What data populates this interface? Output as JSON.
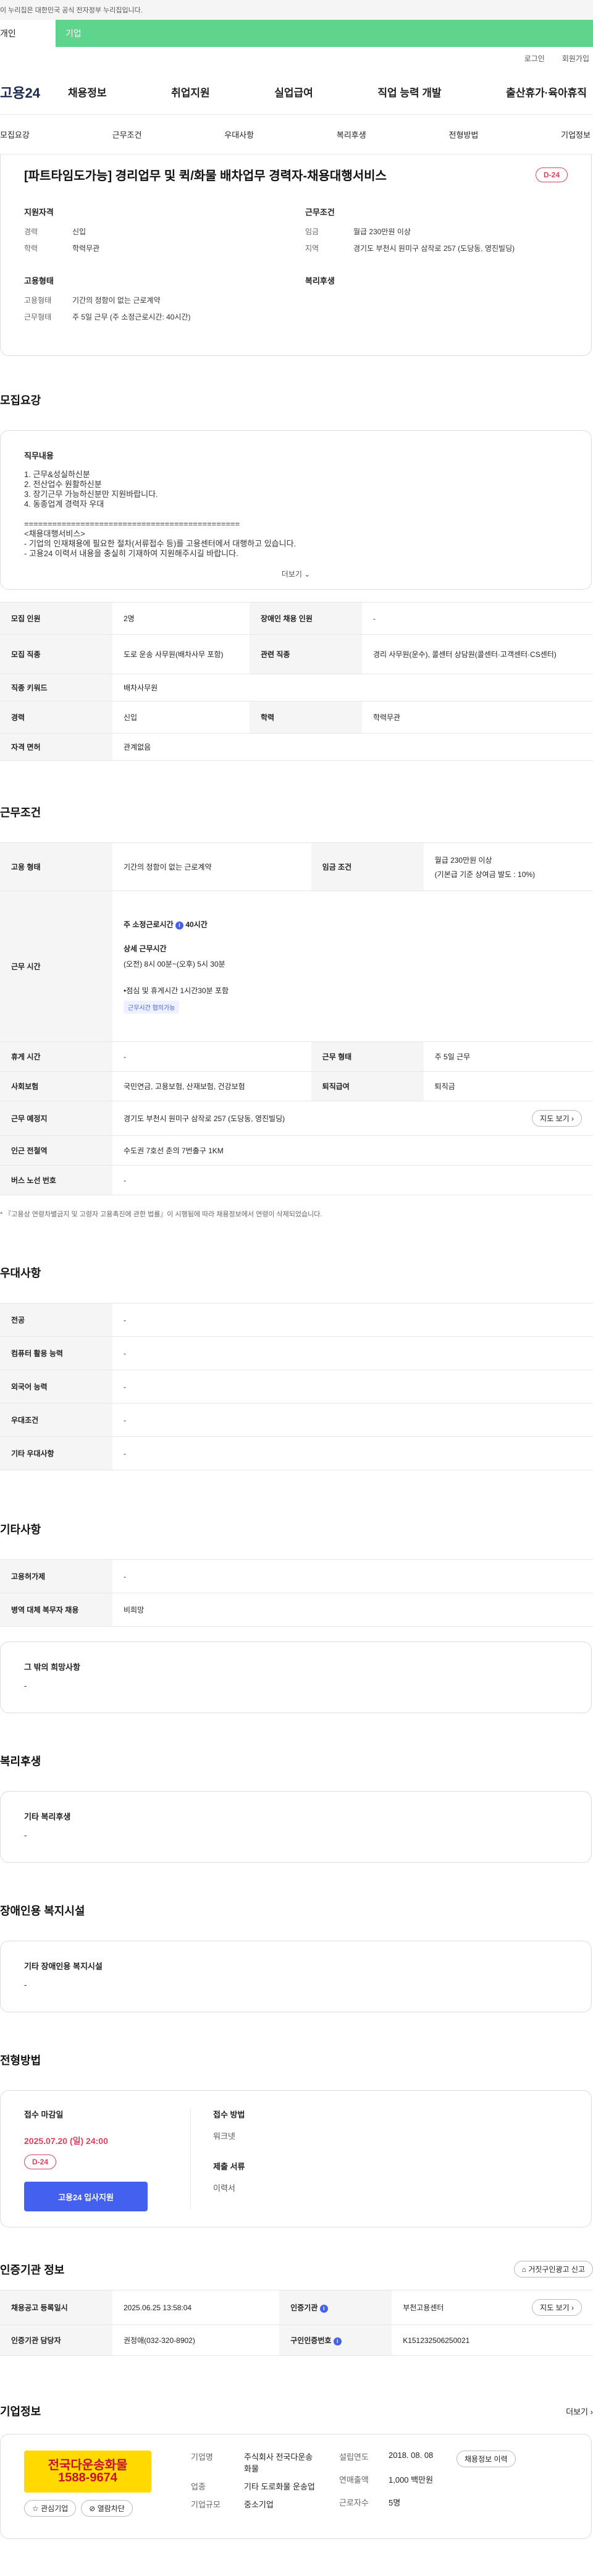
{
  "gov_banner": "이 누리집은 대한민국 공식 전자정부 누리집입니다.",
  "top_tabs": [
    "개인",
    "기업"
  ],
  "util_links": [
    "로그인",
    "회원가입"
  ],
  "brand": "고용24",
  "gnb": [
    "채용정보",
    "취업지원",
    "실업급여",
    "직업 능력 개발",
    "출산휴가·육아휴직"
  ],
  "anchors": [
    "모집요강",
    "근무조건",
    "우대사항",
    "복리후생",
    "전형방법",
    "기업정보"
  ],
  "header": {
    "title": "[파트타임도가능] 경리업무 및 퀵/화물 배차업무 경력자-채용대행서비스",
    "dday": "D-24",
    "qual_title": "지원자격",
    "qual": [
      {
        "k": "경력",
        "v": "신입"
      },
      {
        "k": "학력",
        "v": "학력무관"
      }
    ],
    "cond_title": "근무조건",
    "cond": [
      {
        "k": "임금",
        "v": "월급 230만원 이상"
      },
      {
        "k": "지역",
        "v": "경기도 부천시 원미구 삼작로 257 (도당동, 영진빌딩)"
      }
    ],
    "type_title": "고용형태",
    "type": [
      {
        "k": "고용형태",
        "v": "기간의 정함이 없는 근로계약"
      },
      {
        "k": "근무형태",
        "v": "주 5일 근무 (주 소정근로시간: 40시간)"
      }
    ],
    "welfare_title": "복리후생"
  },
  "recruit": {
    "section_title": "모집요강",
    "desc_title": "직무내용",
    "desc_lines": [
      "1. 근무&성실하신분",
      "2. 전산업수 원활하신분",
      "3. 장기근무 가능하신분만 지원바랍니다.",
      "4. 동종업계 경력자 우대",
      "",
      "==============================================",
      "<채용대행서비스>",
      "- 기업의 인재채용에 필요한 절차(서류접수 등)를 고용센터에서 대행하고 있습니다.",
      "- 고용24 이력서 내용을 충실히 기재하여 지원해주시길 바랍니다."
    ],
    "more": "더보기",
    "rows": [
      {
        "k1": "모집 인원",
        "v1": "2명",
        "k2": "장애인 채용 인원",
        "v2": "-"
      },
      {
        "k1": "모집 직종",
        "v1": "도로 운송 사무원(배차사무 포함)",
        "k2": "관련 직종",
        "v2": "경리 사무원(운수), 콜센터 상담원(콜센터·고객센터·CS센터)"
      },
      {
        "k1": "직종 키워드",
        "v1": "배차사무원"
      },
      {
        "k1": "경력",
        "v1": "신입",
        "k2": "학력",
        "v2": "학력무관"
      },
      {
        "k1": "자격 면허",
        "v1": "관계없음"
      }
    ]
  },
  "work": {
    "section_title": "근무조건",
    "emp_type_k": "고용 형태",
    "emp_type_v": "기간의 정함이 없는 근로계약",
    "wage_k": "임금 조건",
    "wage_v1": "월급 230만원 이상",
    "wage_v2": "(기본급 기준 상여금 발도 : 10%)",
    "hours_k": "근무 시간",
    "hours_week": "주 소정근로시간",
    "hours_week_v": "40시간",
    "hours_detail_t": "상세 근무시간",
    "hours_detail_v": "(오전) 8시 00분~(오후) 5시 30분",
    "hours_break": "•점심 및 휴게시간 1시간30분 포함",
    "hours_chip": "근무시간 협의가능",
    "rest_k": "휴게 시간",
    "rest_v": "-",
    "form_k": "근무 형태",
    "form_v": "주 5일 근무",
    "ins_k": "사회보험",
    "ins_v": "국민연금, 고용보험, 산재보험, 건강보험",
    "sev_k": "퇴직급여",
    "sev_v": "퇴직금",
    "place_k": "근무 예정지",
    "place_v": "경기도 부천시 원미구 삼작로 257 (도당동, 영진빌딩)",
    "map_btn": "지도 보기",
    "subway_k": "인근 전철역",
    "subway_v": "수도권 7호선 춘의 7번출구 1KM",
    "bus_k": "버스 노선 번호",
    "bus_v": "-",
    "note": "* 『고용상 연령차별금지 및 고령자 고용촉진에 관한 법률』이 시행됨에 따라 채용정보에서 연령이 삭제되었습니다."
  },
  "prefer": {
    "section_title": "우대사항",
    "rows": [
      {
        "k": "전공",
        "v": "-"
      },
      {
        "k": "컴퓨터 활용 능력",
        "v": "-"
      },
      {
        "k": "외국어 능력",
        "v": "-"
      },
      {
        "k": "우대조건",
        "v": "-"
      },
      {
        "k": "기타 우대사항",
        "v": "-"
      }
    ]
  },
  "etc": {
    "section_title": "기타사항",
    "rows": [
      {
        "k": "고용허가제",
        "v": "-"
      },
      {
        "k": "병역 대체 복무자 채용",
        "v": "비희망"
      }
    ],
    "box_title": "그 밖의 희망사항",
    "box_v": "-"
  },
  "welfare": {
    "section_title": "복리후생",
    "box_title": "기타 복리후생",
    "box_v": "-"
  },
  "disabled": {
    "section_title": "장애인용 복지시설",
    "box_title": "기타 장애인용 복지시설",
    "box_v": "-"
  },
  "process": {
    "section_title": "전형방법",
    "deadline_t": "접수 마감일",
    "deadline_v": "2025.07.20 (일) 24:00",
    "dday": "D-24",
    "apply_btn": "고용24 입사지원",
    "method_t": "접수 방법",
    "method_v": "워크넷",
    "doc_t": "제출 서류",
    "doc_v": "이력서"
  },
  "agency": {
    "section_title": "인증기관 정보",
    "report_btn": "거짓구인광고 신고",
    "reg_k": "채용공고 등록일시",
    "reg_v": "2025.06.25 13:58:04",
    "agency_k": "인증기관",
    "agency_v": "부천고용센터",
    "map_btn": "지도 보기",
    "staff_k": "인증기관 담당자",
    "staff_v": "권정애(032-320-8902)",
    "no_k": "구인인증번호",
    "no_v": "K151232506250021"
  },
  "company": {
    "section_title": "기업정보",
    "more": "더보기",
    "logo_l1": "전국다운송화물",
    "logo_l2": "1588-9674",
    "fav_btn": "관심기업",
    "block_btn": "열람차단",
    "name_k": "기업명",
    "name_v": "주식회사 전국다운송화물",
    "biz_k": "업종",
    "biz_v": "기타 도로화물 운송업",
    "size_k": "기업규모",
    "size_v": "중소기업",
    "est_k": "설립연도",
    "est_v": "2018. 08. 08",
    "sales_k": "연매출액",
    "sales_v": "1,000 백만원",
    "emp_k": "근로자수",
    "emp_v": "5명",
    "jobs_btn": "채용정보 이력"
  },
  "colors": {
    "accent": "#4361ee",
    "tab": "#5fd48d",
    "dday": "#e04060",
    "logo_bg": "#ffd900"
  }
}
